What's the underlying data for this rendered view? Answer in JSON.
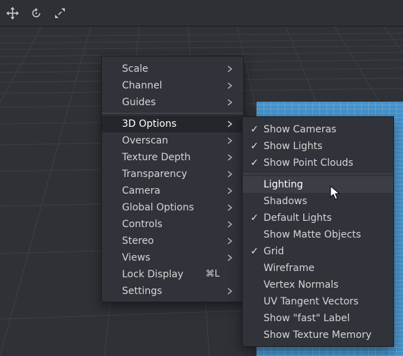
{
  "toolbar": {
    "icons": [
      "move-arrows-icon",
      "rotate-icon",
      "expand-icon"
    ]
  },
  "main_menu": {
    "items": [
      {
        "label": "Scale",
        "submenu": true
      },
      {
        "label": "Channel",
        "submenu": true
      },
      {
        "label": "Guides",
        "submenu": true
      },
      {
        "label": "3D Options",
        "submenu": true,
        "highlight": true
      },
      {
        "label": "Overscan",
        "submenu": true
      },
      {
        "label": "Texture Depth",
        "submenu": true
      },
      {
        "label": "Transparency",
        "submenu": true
      },
      {
        "label": "Camera",
        "submenu": true
      },
      {
        "label": "Global Options",
        "submenu": true
      },
      {
        "label": "Controls",
        "submenu": true
      },
      {
        "label": "Stereo",
        "submenu": true
      },
      {
        "label": "Views",
        "submenu": true
      },
      {
        "label": "Lock Display",
        "shortcut": "⌘L"
      },
      {
        "label": "Settings",
        "submenu": true
      }
    ]
  },
  "sub_menu": {
    "items": [
      {
        "label": "Show Cameras",
        "checked": true
      },
      {
        "label": "Show Lights",
        "checked": true
      },
      {
        "label": "Show Point Clouds",
        "checked": true
      },
      {
        "label": "Lighting",
        "checked": false,
        "hover": true
      },
      {
        "label": "Shadows",
        "checked": false
      },
      {
        "label": "Default Lights",
        "checked": true
      },
      {
        "label": "Show Matte Objects",
        "checked": false
      },
      {
        "label": "Grid",
        "checked": true
      },
      {
        "label": "Wireframe",
        "checked": false
      },
      {
        "label": "Vertex Normals",
        "checked": false
      },
      {
        "label": "UV Tangent Vectors",
        "checked": false
      },
      {
        "label": "Show \"fast\" Label",
        "checked": false
      },
      {
        "label": "Show Texture Memory",
        "checked": false
      }
    ],
    "check_glyph": "✓"
  },
  "colors": {
    "menu_bg": "#30333a",
    "highlight_bg": "#24262b",
    "hover_bg": "#3b3e45",
    "object_blue": "#4aa3e6"
  }
}
